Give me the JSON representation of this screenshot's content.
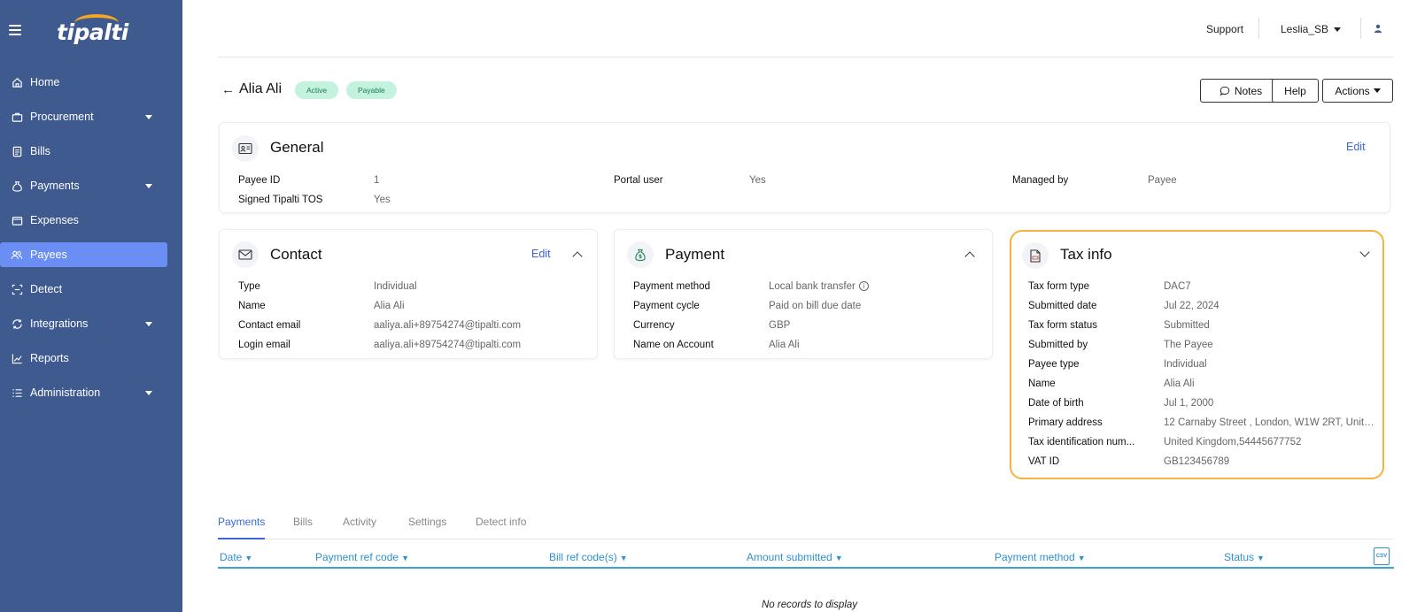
{
  "app": {
    "logo_text": "tipalti"
  },
  "sidebar": {
    "items": [
      {
        "label": "Home",
        "icon": "home-icon",
        "has_submenu": false,
        "active": false
      },
      {
        "label": "Procurement",
        "icon": "briefcase-icon",
        "has_submenu": true,
        "active": false
      },
      {
        "label": "Bills",
        "icon": "bill-icon",
        "has_submenu": false,
        "active": false
      },
      {
        "label": "Payments",
        "icon": "money-bag-icon",
        "has_submenu": true,
        "active": false
      },
      {
        "label": "Expenses",
        "icon": "wallet-icon",
        "has_submenu": false,
        "active": false
      },
      {
        "label": "Payees",
        "icon": "people-icon",
        "has_submenu": false,
        "active": true
      },
      {
        "label": "Detect",
        "icon": "detect-icon",
        "has_submenu": false,
        "active": false
      },
      {
        "label": "Integrations",
        "icon": "integrations-icon",
        "has_submenu": true,
        "active": false
      },
      {
        "label": "Reports",
        "icon": "chart-icon",
        "has_submenu": false,
        "active": false
      },
      {
        "label": "Administration",
        "icon": "list-settings-icon",
        "has_submenu": true,
        "active": false
      }
    ]
  },
  "topbar": {
    "support": "Support",
    "user": "Leslia_SB"
  },
  "header": {
    "payee_name": "Alia Ali",
    "badges": [
      "Active",
      "Payable"
    ],
    "buttons": {
      "notes": "Notes",
      "help": "Help",
      "actions": "Actions"
    }
  },
  "general": {
    "title": "General",
    "edit": "Edit",
    "fields": [
      {
        "label": "Payee ID",
        "value": "1"
      },
      {
        "label": "Signed Tipalti TOS",
        "value": "Yes"
      },
      {
        "label": "Portal user",
        "value": "Yes"
      },
      {
        "label": "Managed by",
        "value": "Payee"
      }
    ]
  },
  "contact": {
    "title": "Contact",
    "edit": "Edit",
    "fields": [
      {
        "label": "Type",
        "value": "Individual"
      },
      {
        "label": "Name",
        "value": "Alia Ali"
      },
      {
        "label": "Contact email",
        "value": "aaliya.ali+89754274@tipalti.com"
      },
      {
        "label": "Login email",
        "value": "aaliya.ali+89754274@tipalti.com"
      }
    ]
  },
  "payment": {
    "title": "Payment",
    "fields": [
      {
        "label": "Payment method",
        "value": "Local bank transfer"
      },
      {
        "label": "Payment cycle",
        "value": "Paid on bill due date"
      },
      {
        "label": "Currency",
        "value": "GBP"
      },
      {
        "label": "Name on Account",
        "value": "Alia Ali"
      }
    ]
  },
  "taxinfo": {
    "title": "Tax info",
    "fields": [
      {
        "label": "Tax form type",
        "value": "DAC7"
      },
      {
        "label": "Submitted date",
        "value": "Jul 22, 2024"
      },
      {
        "label": "Tax form status",
        "value": "Submitted"
      },
      {
        "label": "Submitted by",
        "value": "The Payee"
      },
      {
        "label": "Payee type",
        "value": "Individual"
      },
      {
        "label": "Name",
        "value": "Alia Ali"
      },
      {
        "label": "Date of birth",
        "value": "Jul 1, 2000"
      },
      {
        "label": "Primary address",
        "value": "12 Carnaby Street , London, W1W 2RT, Unite..."
      },
      {
        "label": "Tax identification num...",
        "value": "United Kingdom,54445677752"
      },
      {
        "label": "VAT ID",
        "value": "GB123456789"
      }
    ]
  },
  "tabs": [
    "Payments",
    "Bills",
    "Activity",
    "Settings",
    "Detect info"
  ],
  "table": {
    "columns": [
      "Date",
      "Payment ref code",
      "Bill ref code(s)",
      "Amount submitted",
      "Payment method",
      "Status"
    ],
    "csv_label": "CSV",
    "empty_text": "No records to display"
  },
  "colors": {
    "sidebar": "#3e5a8f",
    "active_nav": "#6b8ef5",
    "accent": "#3a66e0",
    "badge_bg": "#c3f2df",
    "tax_border": "#f5b33a"
  }
}
